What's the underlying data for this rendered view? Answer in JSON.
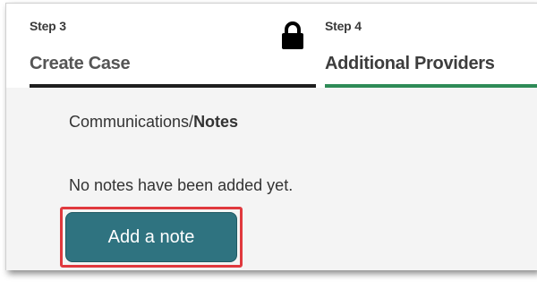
{
  "steps": [
    {
      "number_label": "Step 3",
      "title": "Create Case",
      "locked": true,
      "lock_icon": "lock-icon"
    },
    {
      "number_label": "Step 4",
      "title": "Additional Providers",
      "active": true
    }
  ],
  "section": {
    "title_prefix": "Communications/",
    "title_strong": "Notes"
  },
  "notes": {
    "empty_message": "No notes have been added yet.",
    "add_button_label": "Add a note"
  },
  "colors": {
    "active_step_underline": "#2e8b57",
    "completed_step_underline": "#1e1e1e",
    "button_bg": "#2f7380",
    "highlight_border": "#e0393e"
  }
}
